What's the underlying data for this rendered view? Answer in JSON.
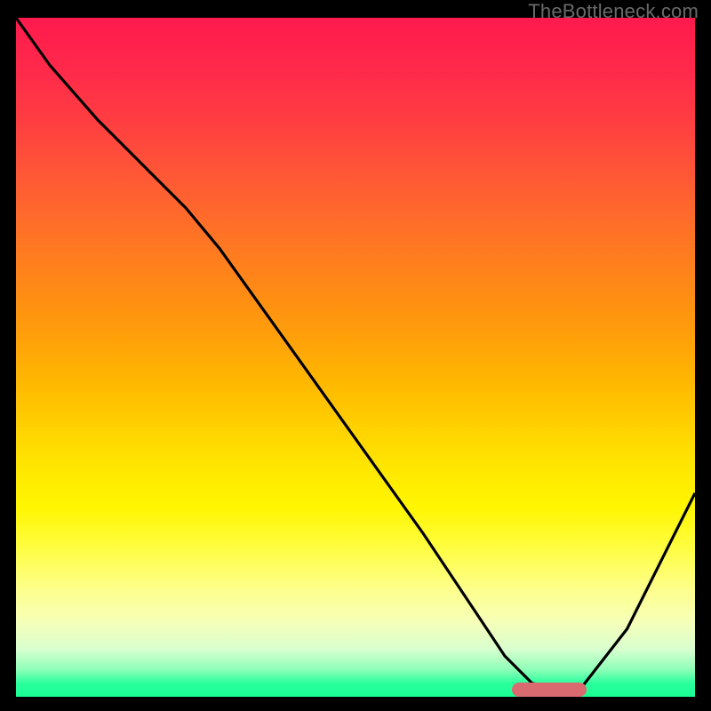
{
  "watermark": "TheBottleneck.com",
  "chart_data": {
    "type": "line",
    "title": "",
    "xlabel": "",
    "ylabel": "",
    "xlim": [
      0,
      100
    ],
    "ylim": [
      0,
      100
    ],
    "series": [
      {
        "name": "curve",
        "x": [
          0,
          5,
          12,
          20,
          25,
          30,
          40,
          50,
          60,
          68,
          72,
          76,
          80,
          83,
          90,
          95,
          100
        ],
        "values": [
          100,
          93,
          85,
          77,
          72,
          66,
          52,
          38,
          24,
          12,
          6,
          2,
          1,
          1,
          10,
          20,
          30
        ]
      }
    ],
    "marker": {
      "x_start": 73,
      "x_end": 84,
      "y": 1
    },
    "background_gradient": {
      "type": "vertical",
      "stops": [
        {
          "pos": 0.0,
          "color": "#ff1a4d",
          "meaning": "high"
        },
        {
          "pos": 0.5,
          "color": "#ffb000",
          "meaning": "mid"
        },
        {
          "pos": 0.9,
          "color": "#f6ffb8",
          "meaning": "low"
        },
        {
          "pos": 1.0,
          "color": "#19ff94",
          "meaning": "optimal"
        }
      ]
    }
  }
}
